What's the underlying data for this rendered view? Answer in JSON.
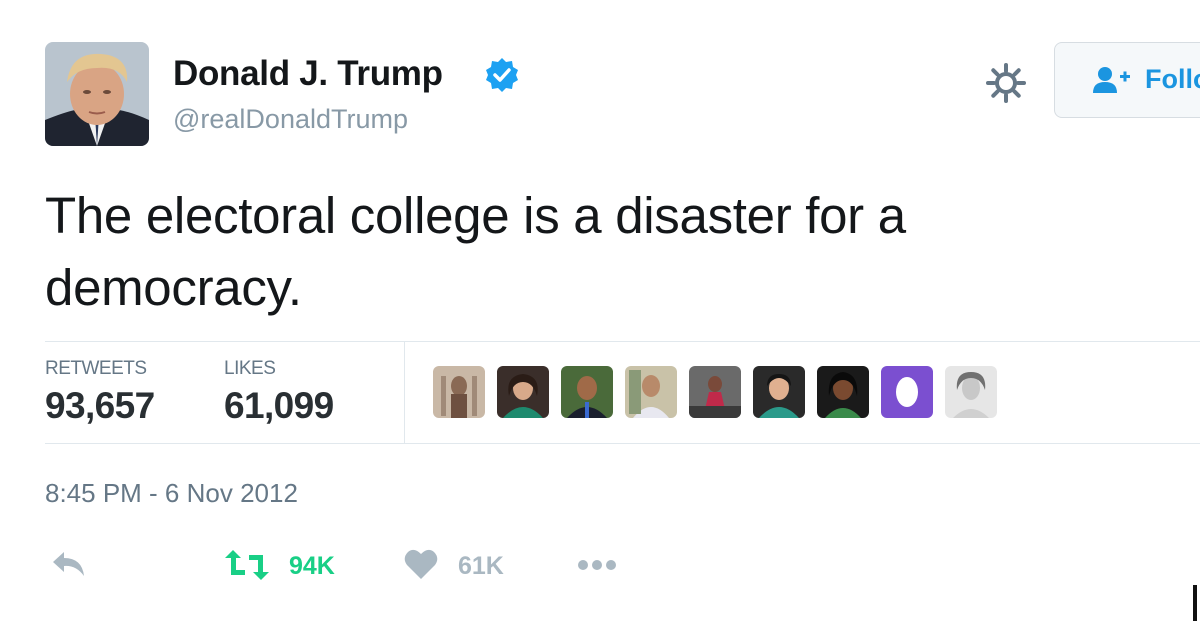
{
  "tweet": {
    "author": {
      "name": "Donald J. Trump",
      "handle": "@realDonaldTrump",
      "verified": true,
      "avatar_icon": "avatar-photo"
    },
    "header": {
      "settings_icon": "gear-icon",
      "follow_label": "Follow",
      "follow_icon": "add-user-icon"
    },
    "text": "The electoral college is a disaster for a democracy.",
    "stats": {
      "retweets_label": "RETWEETS",
      "retweets_value": "93,657",
      "likes_label": "LIKES",
      "likes_value": "61,099"
    },
    "likers_count_shown": 9,
    "timestamp": "8:45 PM - 6 Nov 2012",
    "actions": {
      "reply_icon": "reply-icon",
      "retweet_icon": "retweet-icon",
      "retweet_count": "94K",
      "like_icon": "heart-icon",
      "like_count": "61K",
      "more_icon": "more-icon"
    }
  },
  "colors": {
    "accent": "#1b95e0",
    "retweet_green": "#19cf86",
    "muted": "#8899a6",
    "text": "#14171a",
    "stat_value": "#292f33"
  }
}
